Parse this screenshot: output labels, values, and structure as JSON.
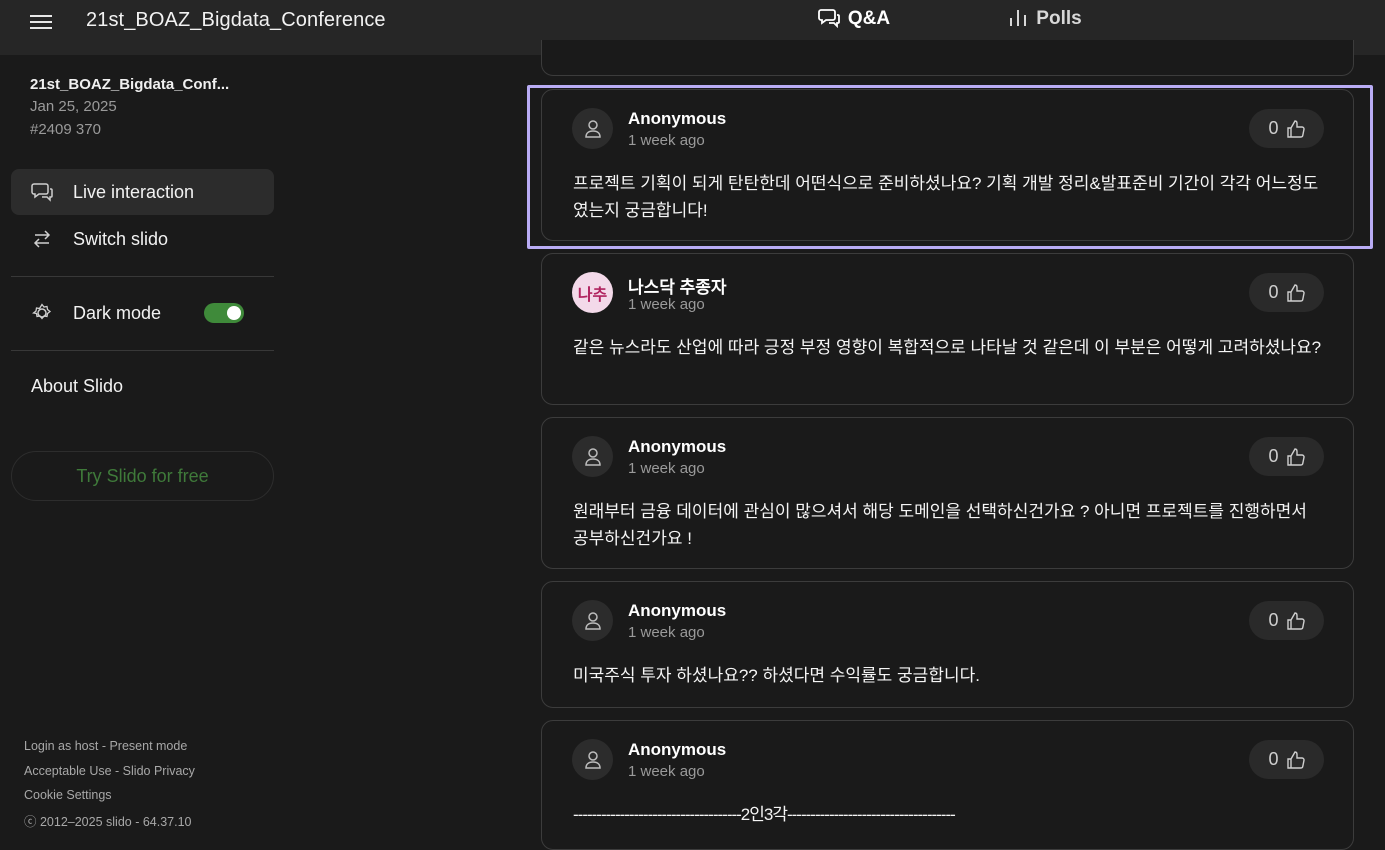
{
  "header": {
    "event_title": "21st_BOAZ_Bigdata_Conference",
    "tabs": [
      {
        "label": "Q&A",
        "icon": "chat-bubbles-icon",
        "active": true
      },
      {
        "label": "Polls",
        "icon": "bar-chart-icon",
        "active": false
      }
    ]
  },
  "sidebar": {
    "event_name": "21st_BOAZ_Bigdata_Conf...",
    "event_date": "Jan 25, 2025",
    "event_code": "#2409 370",
    "items": [
      {
        "label": "Live interaction",
        "icon": "chat-bubbles-icon",
        "active": true
      },
      {
        "label": "Switch slido",
        "icon": "switch-arrows-icon",
        "active": false
      }
    ],
    "dark_mode": {
      "label": "Dark mode",
      "icon": "gear-sun-icon",
      "enabled": true
    },
    "about": "About Slido",
    "try_button": "Try Slido for free",
    "footer": {
      "login_host": "Login as host",
      "sep1": " - ",
      "present_mode": "Present mode",
      "acceptable_use": "Acceptable Use",
      "sep2": " - ",
      "privacy": "Slido Privacy",
      "cookie": "Cookie Settings",
      "copyright": "ⓒ 2012–2025 slido - 64.37.10"
    }
  },
  "questions": [
    {
      "author": "Anonymous",
      "time": "1 week ago",
      "likes": "0",
      "text": "프로젝트 기획이 되게 탄탄한데 어떤식으로 준비하셨나요? 기획 개발 정리&발표준비 기간이 각각 어느정도였는지 궁금합니다!",
      "avatar": "user-icon"
    },
    {
      "author": "나스닥 추종자",
      "time": "1 week ago",
      "likes": "0",
      "text": "같은 뉴스라도 산업에 따라 긍정 부정 영향이 복합적으로 나타날 것 같은데 이 부분은 어떻게 고려하셨나요?",
      "avatar_initials": "나추"
    },
    {
      "author": "Anonymous",
      "time": "1 week ago",
      "likes": "0",
      "text": "원래부터 금융 데이터에 관심이 많으셔서 해당 도메인을 선택하신건가요 ? 아니면 프로젝트를 진행하면서 공부하신건가요 !",
      "avatar": "user-icon"
    },
    {
      "author": "Anonymous",
      "time": "1 week ago",
      "likes": "0",
      "text": "미국주식 투자 하셨나요?? 하셨다면 수익률도 궁금합니다.",
      "avatar": "user-icon"
    },
    {
      "author": "Anonymous",
      "time": "1 week ago",
      "likes": "0",
      "text": "------------------------------------2인3각------------------------------------",
      "avatar": "user-icon"
    }
  ],
  "colors": {
    "accent_green": "#3f8a3a",
    "highlight_border": "#b9acf5",
    "background": "#1a1a1a",
    "topbar": "#262626"
  }
}
